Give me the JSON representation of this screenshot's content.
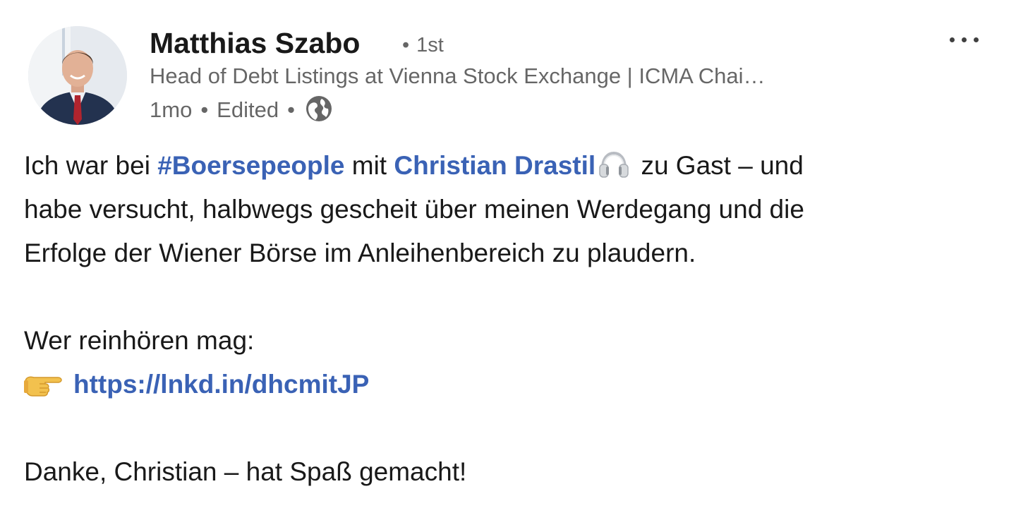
{
  "author": {
    "name": "Matthias Szabo",
    "degree_separator": "•",
    "degree": "1st",
    "headline": "Head of Debt Listings at Vienna Stock Exchange | ICMA Chai…",
    "time": "1mo",
    "meta_separator": "•",
    "edited": "Edited",
    "visibility_separator": "•",
    "visibility_icon": "globe-icon",
    "avatar_icon": "profile-photo"
  },
  "menu": {
    "icon": "more-options-icon"
  },
  "post": {
    "line1_a": "Ich war bei ",
    "hashtag": "#Boersepeople",
    "line1_b": " mit ",
    "mention": "Christian Drastil",
    "headphones_icon": "headphones-emoji",
    "line1_c": " zu Gast – und",
    "line2": "habe versucht, halbwegs gescheit über meinen Werdegang und die",
    "line3": "Erfolge der Wiener Börse im Anleihenbereich zu plaudern.",
    "line4": "Wer reinhören mag:",
    "pointing_icon": "pointing-right-emoji",
    "link": "https://lnkd.in/dhcmitJP",
    "line6": "Danke, Christian – hat Spaß gemacht!"
  },
  "colors": {
    "link": "#3a62b5",
    "text": "#1a1a1a",
    "muted": "#666666"
  }
}
